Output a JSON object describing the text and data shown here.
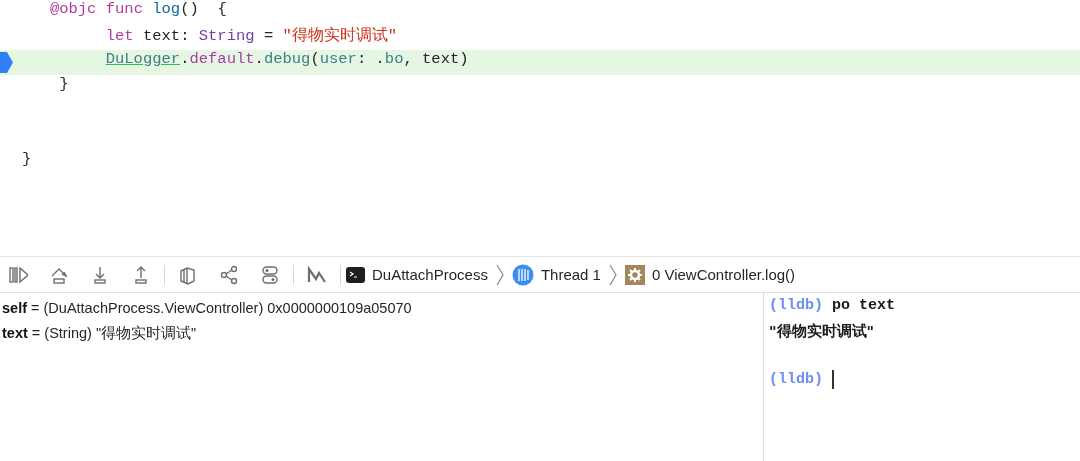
{
  "editor": {
    "lines": [
      {
        "current": false,
        "breakpoint": false,
        "tokens": [
          {
            "kind": "keyword",
            "text": "   @objc"
          },
          {
            "kind": "keyword",
            "text": " func"
          },
          {
            "kind": "function",
            "text": " log"
          },
          {
            "kind": "plain",
            "text": "()  {"
          }
        ]
      },
      {
        "current": false,
        "breakpoint": false,
        "tokens": [
          {
            "kind": "keyword",
            "text": "         let"
          },
          {
            "kind": "plain",
            "text": " text: "
          },
          {
            "kind": "type",
            "text": "String"
          },
          {
            "kind": "plain",
            "text": " = "
          },
          {
            "kind": "string",
            "text": "\"得物实时调试\""
          }
        ]
      },
      {
        "current": true,
        "breakpoint": true,
        "tokens": [
          {
            "kind": "class",
            "text": "         DuLogger"
          },
          {
            "kind": "plain",
            "text": "."
          },
          {
            "kind": "keyword",
            "text": "default"
          },
          {
            "kind": "plain",
            "text": "."
          },
          {
            "kind": "member",
            "text": "debug"
          },
          {
            "kind": "plain",
            "text": "("
          },
          {
            "kind": "member",
            "text": "user"
          },
          {
            "kind": "plain",
            "text": ": ."
          },
          {
            "kind": "member",
            "text": "bo"
          },
          {
            "kind": "plain",
            "text": ", text)"
          }
        ]
      },
      {
        "current": false,
        "breakpoint": false,
        "tokens": [
          {
            "kind": "plain",
            "text": "    }"
          }
        ]
      },
      {
        "current": false,
        "breakpoint": false
      },
      {
        "current": false,
        "breakpoint": false
      },
      {
        "current": false,
        "breakpoint": false,
        "tokens": [
          {
            "kind": "plain",
            "text": "}"
          }
        ]
      }
    ]
  },
  "debug_bar": {
    "breadcrumb": [
      {
        "kind": "process",
        "label": "DuAttachProcess"
      },
      {
        "kind": "thread",
        "label": "Thread 1"
      },
      {
        "kind": "frame",
        "label": "0 ViewController.log()"
      }
    ]
  },
  "variables": [
    "**self** = (DuAttachProcess.ViewController) 0x0000000109a05070",
    "**text** = (String) \"得物实时调试\""
  ],
  "console": {
    "lines": [
      {
        "kind": "command",
        "prompt": "(lldb)",
        "text": "po text"
      },
      {
        "kind": "output",
        "text": "\"得物实时调试\""
      },
      {
        "kind": "blank"
      },
      {
        "kind": "input",
        "prompt": "(lldb)"
      }
    ]
  }
}
